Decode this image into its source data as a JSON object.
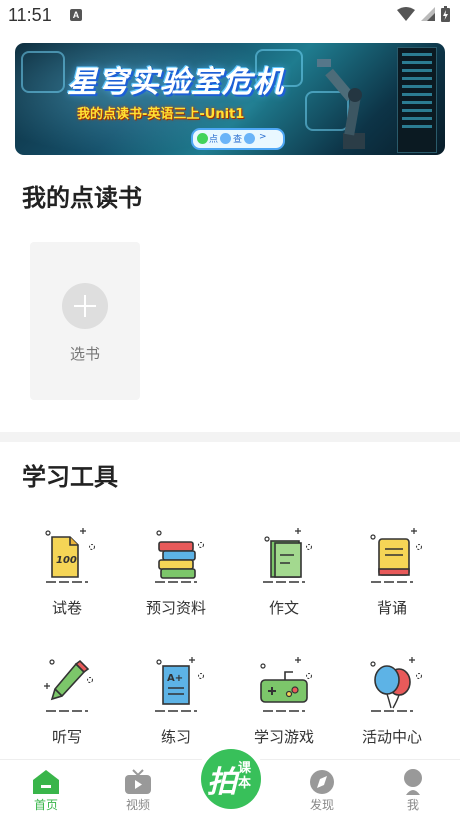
{
  "status_bar": {
    "time": "11:51",
    "notification_icon": "A"
  },
  "banner": {
    "title": "星穹实验室危机",
    "subtitle": "我的点读书-英语三上-Unit1",
    "pill_left": "点",
    "pill_right": "查"
  },
  "my_books": {
    "title": "我的点读书",
    "select_label": "选书"
  },
  "tools": {
    "title": "学习工具",
    "items": [
      {
        "label": "试卷",
        "icon": "exam-paper-icon"
      },
      {
        "label": "预习资料",
        "icon": "book-stack-icon"
      },
      {
        "label": "作文",
        "icon": "notebook-icon"
      },
      {
        "label": "背诵",
        "icon": "recite-book-icon"
      },
      {
        "label": "听写",
        "icon": "pencil-icon"
      },
      {
        "label": "练习",
        "icon": "practice-paper-icon"
      },
      {
        "label": "学习游戏",
        "icon": "gamepad-icon"
      },
      {
        "label": "活动中心",
        "icon": "balloons-icon"
      }
    ]
  },
  "bottom_nav": {
    "items": [
      {
        "label": "首页",
        "icon": "home-icon",
        "active": true
      },
      {
        "label": "视频",
        "icon": "tv-icon",
        "active": false
      },
      {
        "label": "发现",
        "icon": "compass-icon",
        "active": false
      },
      {
        "label": "我",
        "icon": "profile-icon",
        "active": false
      }
    ],
    "center": {
      "big": "拍",
      "small": "课本"
    }
  },
  "colors": {
    "accent": "#39b54a",
    "banner_title_shadow": "#1d5fd6",
    "banner_subtitle": "#ffe234"
  }
}
